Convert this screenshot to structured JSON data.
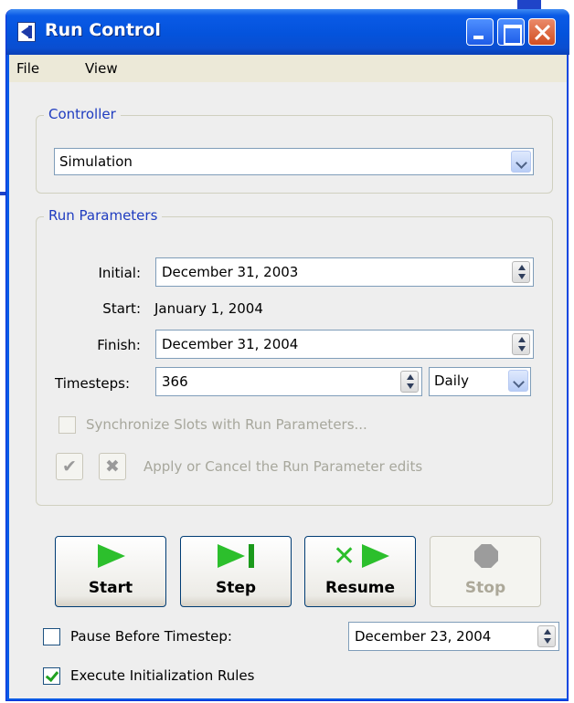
{
  "window": {
    "title": "Run Control"
  },
  "menu": {
    "file": "File",
    "view": "View"
  },
  "controller": {
    "group_title": "Controller",
    "selected": "Simulation"
  },
  "run_parameters": {
    "group_title": "Run Parameters",
    "initial_label": "Initial:",
    "initial_value": "December 31, 2003",
    "start_label": "Start:",
    "start_value": "January 1, 2004",
    "finish_label": "Finish:",
    "finish_value": "December 31, 2004",
    "timesteps_label": "Timesteps:",
    "timesteps_value": "366",
    "timestep_unit": "Daily",
    "sync_label": "Synchronize Slots with Run Parameters...",
    "sync_checked": false,
    "apply_cancel_label": "Apply or Cancel the Run Parameter edits"
  },
  "buttons": {
    "start": "Start",
    "step": "Step",
    "resume": "Resume",
    "stop": "Stop"
  },
  "pause": {
    "label": "Pause Before Timestep:",
    "checked": false,
    "value": "December 23, 2004"
  },
  "init_rules": {
    "label": "Execute Initialization Rules",
    "checked": true
  },
  "icons": {
    "start": "play-icon",
    "step": "step-icon",
    "resume": "resume-icon",
    "stop": "stop-icon",
    "apply": "checkmark-icon",
    "cancel": "cancel-x-icon"
  }
}
